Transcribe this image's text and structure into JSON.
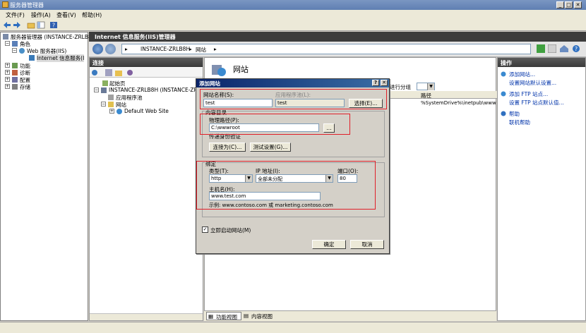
{
  "window": {
    "title": "服务器管理器"
  },
  "menu": {
    "file": "文件(F)",
    "action": "操作(A)",
    "view": "查看(V)",
    "help": "帮助(H)"
  },
  "tree": {
    "root": "服务器管理器 (INSTANCE-ZRLB8",
    "roles": "角色",
    "web_server": "Web 服务器(IIS)",
    "iis_manager": "Internet 信息服务(I",
    "features": "功能",
    "diagnostics": "诊断",
    "config": "配置",
    "storage": "存储"
  },
  "iis": {
    "header_title": "Internet 信息服务(IIS)管理器",
    "breadcrumb": {
      "server": "INSTANCE-ZRLB8H",
      "sites": "网站"
    },
    "connections_title": "连接",
    "conn_tree": {
      "start_page": "起始页",
      "server": "INSTANCE-ZRLB8H (INSTANCE-ZRLB8H\\",
      "app_pools": "应用程序池",
      "sites": "网站",
      "default_site": "Default Web Site"
    },
    "content_title": "网站",
    "group_by_tail": "进行分组",
    "col_path": "路径",
    "path_cell": "%SystemDrive%\\inetpub\\www",
    "tabs": {
      "features": "功能视图",
      "content": "内容视图"
    }
  },
  "actions": {
    "title": "操作",
    "items": [
      "添加网站...",
      "设置网站默认设置...",
      "添加 FTP 站点...",
      "设置 FTP 站点默认值...",
      "帮助",
      "联机帮助"
    ]
  },
  "dialog": {
    "title": "添加网站",
    "help_btn": "?",
    "close_btn": "✕",
    "site_name_label": "网站名称(S):",
    "site_name_value": "test",
    "app_pool_label": "应用程序池(L):",
    "app_pool_value": "test",
    "select_btn": "选择(E)...",
    "content_dir_label": "内容目录",
    "physical_path_label": "物理路径(P):",
    "physical_path_value": "C:\\wwwroot",
    "browse_btn": "...",
    "pass_auth_label": "传递身份验证",
    "connect_as_btn": "连接为(C)...",
    "test_settings_btn": "测试设置(G)...",
    "binding_label": "绑定",
    "type_label": "类型(T):",
    "type_value": "http",
    "ip_label": "IP 地址(I):",
    "ip_value": "全部未分配",
    "port_label": "端口(O):",
    "port_value": "80",
    "hostname_label": "主机名(H):",
    "hostname_value": "www.test.com",
    "example_text": "示例: www.contoso.com 或 marketing.contoso.com",
    "start_now_label": "立即启动网站(M)",
    "start_now_checked": "✓",
    "ok_btn": "确定",
    "cancel_btn": "取消"
  },
  "colors": {
    "highlight": "#e0202a",
    "dialog_title": "#0a246a",
    "header": "#3c3c3c"
  }
}
